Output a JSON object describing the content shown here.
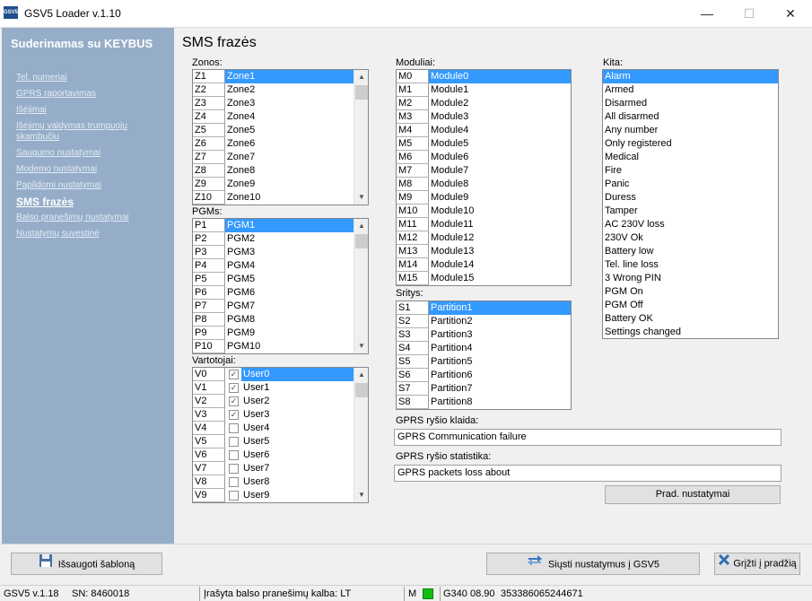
{
  "window": {
    "title": "GSV5 Loader v.1.10",
    "icon_text": "GSV5",
    "controls": {
      "minimize": "—",
      "maximize": "☐",
      "close": "✕"
    }
  },
  "sidebar": {
    "title": "Suderinamas su KEYBUS",
    "items": [
      {
        "label": "Tel. numeriai"
      },
      {
        "label": "GPRS raportavimas"
      },
      {
        "label": "Išėjimai"
      },
      {
        "label": "Išėjimų valdymas trumpuoju skambučiu"
      },
      {
        "label": "Saugumo nustatymai"
      },
      {
        "label": "Modemo nustatymai"
      },
      {
        "label": "Papildomi nustatymai"
      },
      {
        "label": "SMS frazės"
      },
      {
        "label": "Balso pranešimų nustatymai"
      },
      {
        "label": "Nustatymų suvestinė"
      }
    ]
  },
  "main": {
    "title": "SMS frazės",
    "zones": {
      "label": "Zonos:",
      "rows": [
        [
          "Z1",
          "Zone1"
        ],
        [
          "Z2",
          "Zone2"
        ],
        [
          "Z3",
          "Zone3"
        ],
        [
          "Z4",
          "Zone4"
        ],
        [
          "Z5",
          "Zone5"
        ],
        [
          "Z6",
          "Zone6"
        ],
        [
          "Z7",
          "Zone7"
        ],
        [
          "Z8",
          "Zone8"
        ],
        [
          "Z9",
          "Zone9"
        ],
        [
          "Z10",
          "Zone10"
        ]
      ]
    },
    "pgms": {
      "label": "PGMs:",
      "rows": [
        [
          "P1",
          "PGM1"
        ],
        [
          "P2",
          "PGM2"
        ],
        [
          "P3",
          "PGM3"
        ],
        [
          "P4",
          "PGM4"
        ],
        [
          "P5",
          "PGM5"
        ],
        [
          "P6",
          "PGM6"
        ],
        [
          "P7",
          "PGM7"
        ],
        [
          "P8",
          "PGM8"
        ],
        [
          "P9",
          "PGM9"
        ],
        [
          "P10",
          "PGM10"
        ]
      ]
    },
    "users": {
      "label": "Vartotojai:",
      "rows": [
        [
          "V0",
          "User0",
          true
        ],
        [
          "V1",
          "User1",
          true
        ],
        [
          "V2",
          "User2",
          true
        ],
        [
          "V3",
          "User3",
          true
        ],
        [
          "V4",
          "User4",
          false
        ],
        [
          "V5",
          "User5",
          false
        ],
        [
          "V6",
          "User6",
          false
        ],
        [
          "V7",
          "User7",
          false
        ],
        [
          "V8",
          "User8",
          false
        ],
        [
          "V9",
          "User9",
          false
        ]
      ]
    },
    "modules": {
      "label": "Moduliai:",
      "rows": [
        [
          "M0",
          "Module0"
        ],
        [
          "M1",
          "Module1"
        ],
        [
          "M2",
          "Module2"
        ],
        [
          "M3",
          "Module3"
        ],
        [
          "M4",
          "Module4"
        ],
        [
          "M5",
          "Module5"
        ],
        [
          "M6",
          "Module6"
        ],
        [
          "M7",
          "Module7"
        ],
        [
          "M8",
          "Module8"
        ],
        [
          "M9",
          "Module9"
        ],
        [
          "M10",
          "Module10"
        ],
        [
          "M11",
          "Module11"
        ],
        [
          "M12",
          "Module12"
        ],
        [
          "M13",
          "Module13"
        ],
        [
          "M14",
          "Module14"
        ],
        [
          "M15",
          "Module15"
        ]
      ]
    },
    "partitions": {
      "label": "Sritys:",
      "rows": [
        [
          "S1",
          "Partition1"
        ],
        [
          "S2",
          "Partition2"
        ],
        [
          "S3",
          "Partition3"
        ],
        [
          "S4",
          "Partition4"
        ],
        [
          "S5",
          "Partition5"
        ],
        [
          "S6",
          "Partition6"
        ],
        [
          "S7",
          "Partition7"
        ],
        [
          "S8",
          "Partition8"
        ]
      ]
    },
    "other": {
      "label": "Kita:",
      "items": [
        "Alarm",
        "Armed",
        "Disarmed",
        "All disarmed",
        "Any number",
        "Only registered",
        "Medical",
        "Fire",
        "Panic",
        "Duress",
        "Tamper",
        "AC 230V loss",
        "230V Ok",
        "Battery low",
        "Tel. line loss",
        "3 Wrong PIN",
        "PGM On",
        "PGM Off",
        "Battery OK",
        "Settings changed"
      ]
    },
    "gprs_error": {
      "label": "GPRS ryšio klaida:",
      "value": "GPRS Communication failure"
    },
    "gprs_stats": {
      "label": "GPRS ryšio statistika:",
      "value": "GPRS packets loss about"
    },
    "defaults_button": "Prad. nustatymai"
  },
  "footer": {
    "save_template": "Išsaugoti šabloną",
    "send_settings": "Siųsti nustatymus į GSV5",
    "back_to_start": "Grįžti į pradžią"
  },
  "statusbar": {
    "version": "GSV5 v.1.18",
    "sn": "SN: 8460018",
    "voice_language": "Įrašyta balso pranešimų kalba: LT",
    "mode": "M",
    "modem": "G340 08.90",
    "imei": "353386065244671",
    "led_color": "#10c010"
  },
  "colors": {
    "sidebar": "#95adc8",
    "selection": "#3399ff"
  }
}
